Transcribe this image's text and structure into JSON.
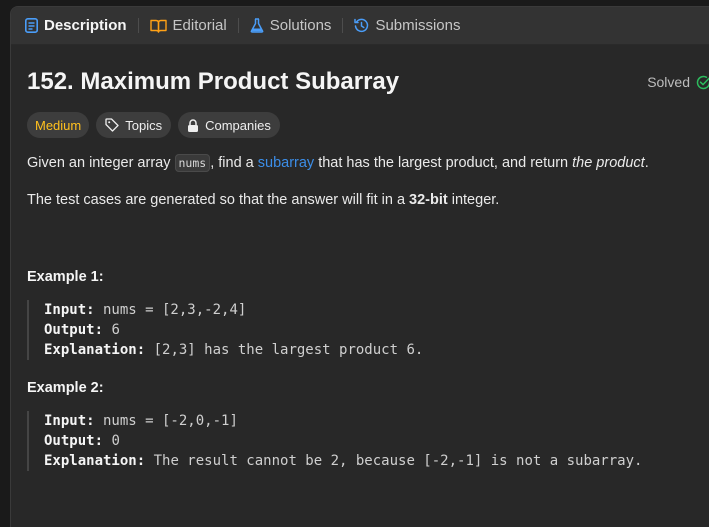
{
  "tabs": [
    {
      "label": "Description",
      "icon": "document-icon",
      "active": true
    },
    {
      "label": "Editorial",
      "icon": "book-icon",
      "active": false
    },
    {
      "label": "Solutions",
      "icon": "flask-icon",
      "active": false
    },
    {
      "label": "Submissions",
      "icon": "history-icon",
      "active": false
    }
  ],
  "problem": {
    "title": "152. Maximum Product Subarray",
    "status": "Solved",
    "status_color": "#2cbb5d"
  },
  "tags": {
    "difficulty": "Medium",
    "difficulty_color": "#ffc01e",
    "topics": "Topics",
    "companies": "Companies"
  },
  "description": {
    "p1_a": "Given an integer array ",
    "p1_code": "nums",
    "p1_b": ", find a ",
    "p1_link": "subarray",
    "p1_c": " that has the largest product, and return ",
    "p1_em": "the product",
    "p1_d": ".",
    "p2_a": "The test cases are generated so that the answer will fit in a ",
    "p2_strong": "32-bit",
    "p2_b": " integer."
  },
  "examples": [
    {
      "title": "Example 1:",
      "input_label": "Input:",
      "input": " nums = [2,3,-2,4]",
      "output_label": "Output:",
      "output": " 6",
      "explanation_label": "Explanation:",
      "explanation": " [2,3] has the largest product 6."
    },
    {
      "title": "Example 2:",
      "input_label": "Input:",
      "input": " nums = [-2,0,-1]",
      "output_label": "Output:",
      "output": " 0",
      "explanation_label": "Explanation:",
      "explanation": " The result cannot be 2, because [-2,-1] is not a subarray."
    }
  ]
}
